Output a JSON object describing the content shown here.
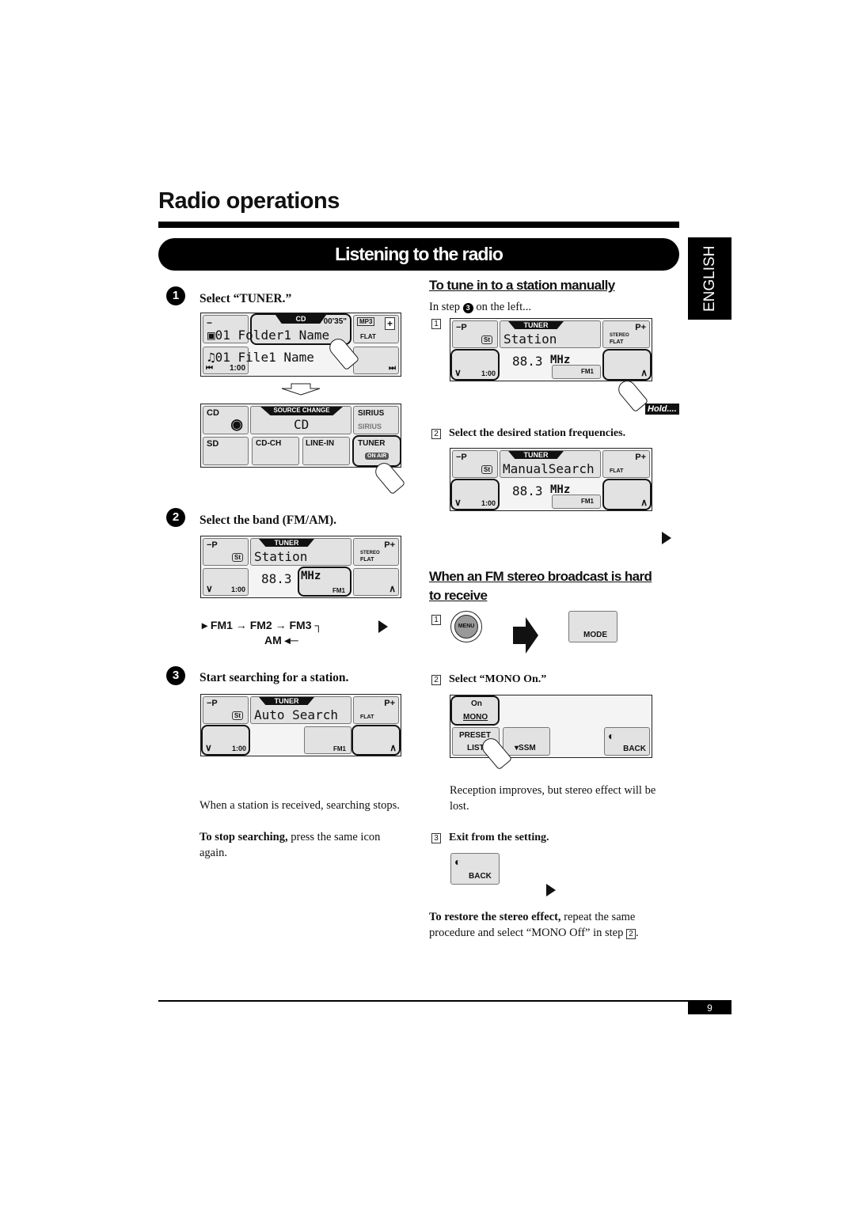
{
  "page_title": "Radio operations",
  "banner": "Listening to the radio",
  "language_tab": "ENGLISH",
  "page_number": "9",
  "left": {
    "step1": {
      "num": "1",
      "label": "Select “TUNER.”",
      "cd_screen": {
        "tag": "CD",
        "time": "00'35\"",
        "folder": "01 Folder1 Name",
        "file": "01 File1 Name",
        "elapsed": "1:00",
        "mp3": "MP3",
        "flat": "FLAT",
        "minus": "−",
        "plus": "+"
      },
      "source_screen": {
        "tag": "SOURCE CHANGE",
        "current": "CD",
        "buttons": [
          "CD",
          "SIRIUS",
          "SD",
          "CD-CH",
          "LINE-IN",
          "TUNER"
        ],
        "sirius_logo": "SIRIUS",
        "on_air": "ON AIR"
      }
    },
    "step2": {
      "num": "2",
      "label": "Select the band (FM/AM).",
      "screen": {
        "tag": "TUNER",
        "name": "Station",
        "freq": "88.3",
        "unit": "MHz",
        "band": "FM1",
        "time": "1:00",
        "pminus": "−P",
        "pplus": "P+",
        "st": "St",
        "stereo": "STEREO",
        "flat": "FLAT"
      },
      "bands": [
        "FM1",
        "FM2",
        "FM3",
        "AM"
      ]
    },
    "step3": {
      "num": "3",
      "label": "Start searching for a station.",
      "screen": {
        "tag": "TUNER",
        "name": "Auto Search",
        "band": "FM1",
        "time": "1:00",
        "pminus": "−P",
        "pplus": "P+",
        "st": "St",
        "flat": "FLAT"
      },
      "note1": "When a station is received, searching stops.",
      "note2_bold": "To stop searching,",
      "note2": " press the same icon again."
    }
  },
  "right": {
    "manual": {
      "heading": "To tune in to a station manually",
      "intro_pre": "In step ",
      "intro_num": "3",
      "intro_post": " on the left...",
      "s1": {
        "num": "1",
        "screen": {
          "tag": "TUNER",
          "name": "Station",
          "freq": "88.3",
          "unit": "MHz",
          "band": "FM1",
          "time": "1:00",
          "pminus": "−P",
          "pplus": "P+",
          "st": "St",
          "stereo": "STEREO",
          "flat": "FLAT"
        },
        "hold": "Hold...."
      },
      "s2": {
        "num": "2",
        "label": "Select the desired station frequencies.",
        "screen": {
          "tag": "TUNER",
          "name": "ManualSearch",
          "freq": "88.3",
          "unit": "MHz",
          "band": "FM1",
          "time": "1:00",
          "pminus": "−P",
          "pplus": "P+",
          "st": "St",
          "flat": "FLAT"
        }
      }
    },
    "mono": {
      "heading": "When an FM stereo broadcast is hard to receive",
      "s1": {
        "num": "1",
        "menu": "MENU",
        "mode": "MODE"
      },
      "s2": {
        "num": "2",
        "label": "Select “MONO On.”",
        "on": "On",
        "mono": "MONO",
        "preset": "PRESET",
        "list": "LIST",
        "ssm": "SSM",
        "back": "BACK"
      },
      "note": "Reception improves, but stereo effect will be lost.",
      "s3": {
        "num": "3",
        "label": "Exit from the setting.",
        "back": "BACK"
      },
      "restore_bold": "To restore the stereo effect,",
      "restore": " repeat the same procedure and select “MONO Off” in step ",
      "restore_step": "2",
      "restore_end": "."
    }
  }
}
